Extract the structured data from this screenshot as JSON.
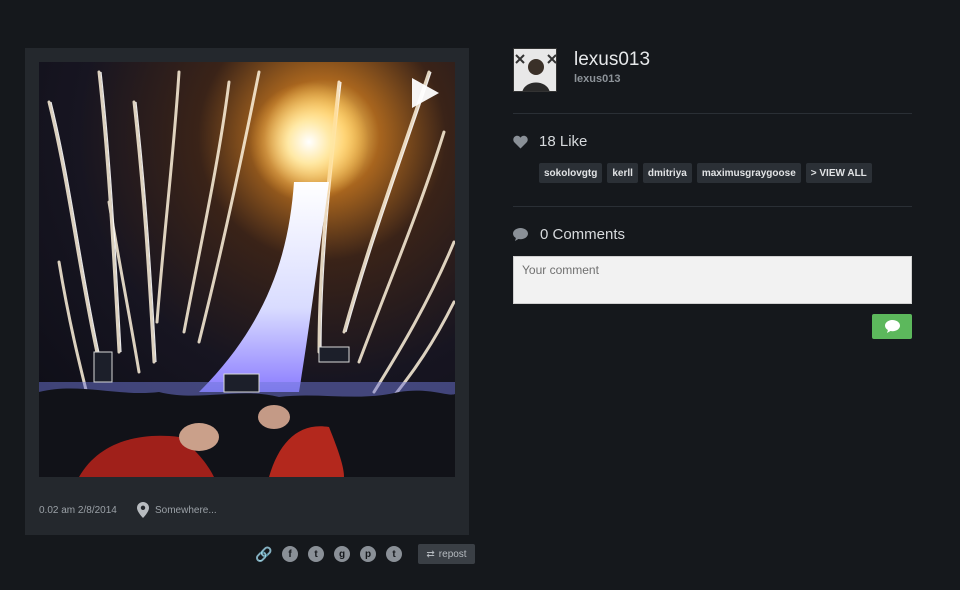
{
  "post": {
    "time": "0.02 am 2/8/2014",
    "location": "Somewhere...",
    "media_type": "video"
  },
  "share": {
    "icons": [
      "link-icon",
      "facebook-icon",
      "twitter-icon",
      "google-plus-icon",
      "pinterest-icon",
      "tumblr-icon"
    ],
    "repost_label": "repost"
  },
  "user": {
    "name": "lexus013",
    "handle": "lexus013"
  },
  "likes": {
    "label": "18 Like",
    "users": [
      "sokolovgtg",
      "kerll",
      "dmitriya",
      "maximusgraygoose"
    ],
    "view_all_label": "> VIEW ALL"
  },
  "comments": {
    "label": "0 Comments",
    "placeholder": "Your comment"
  },
  "colors": {
    "background": "#15181c",
    "card": "#24282d",
    "send_button": "#5cb85c"
  }
}
